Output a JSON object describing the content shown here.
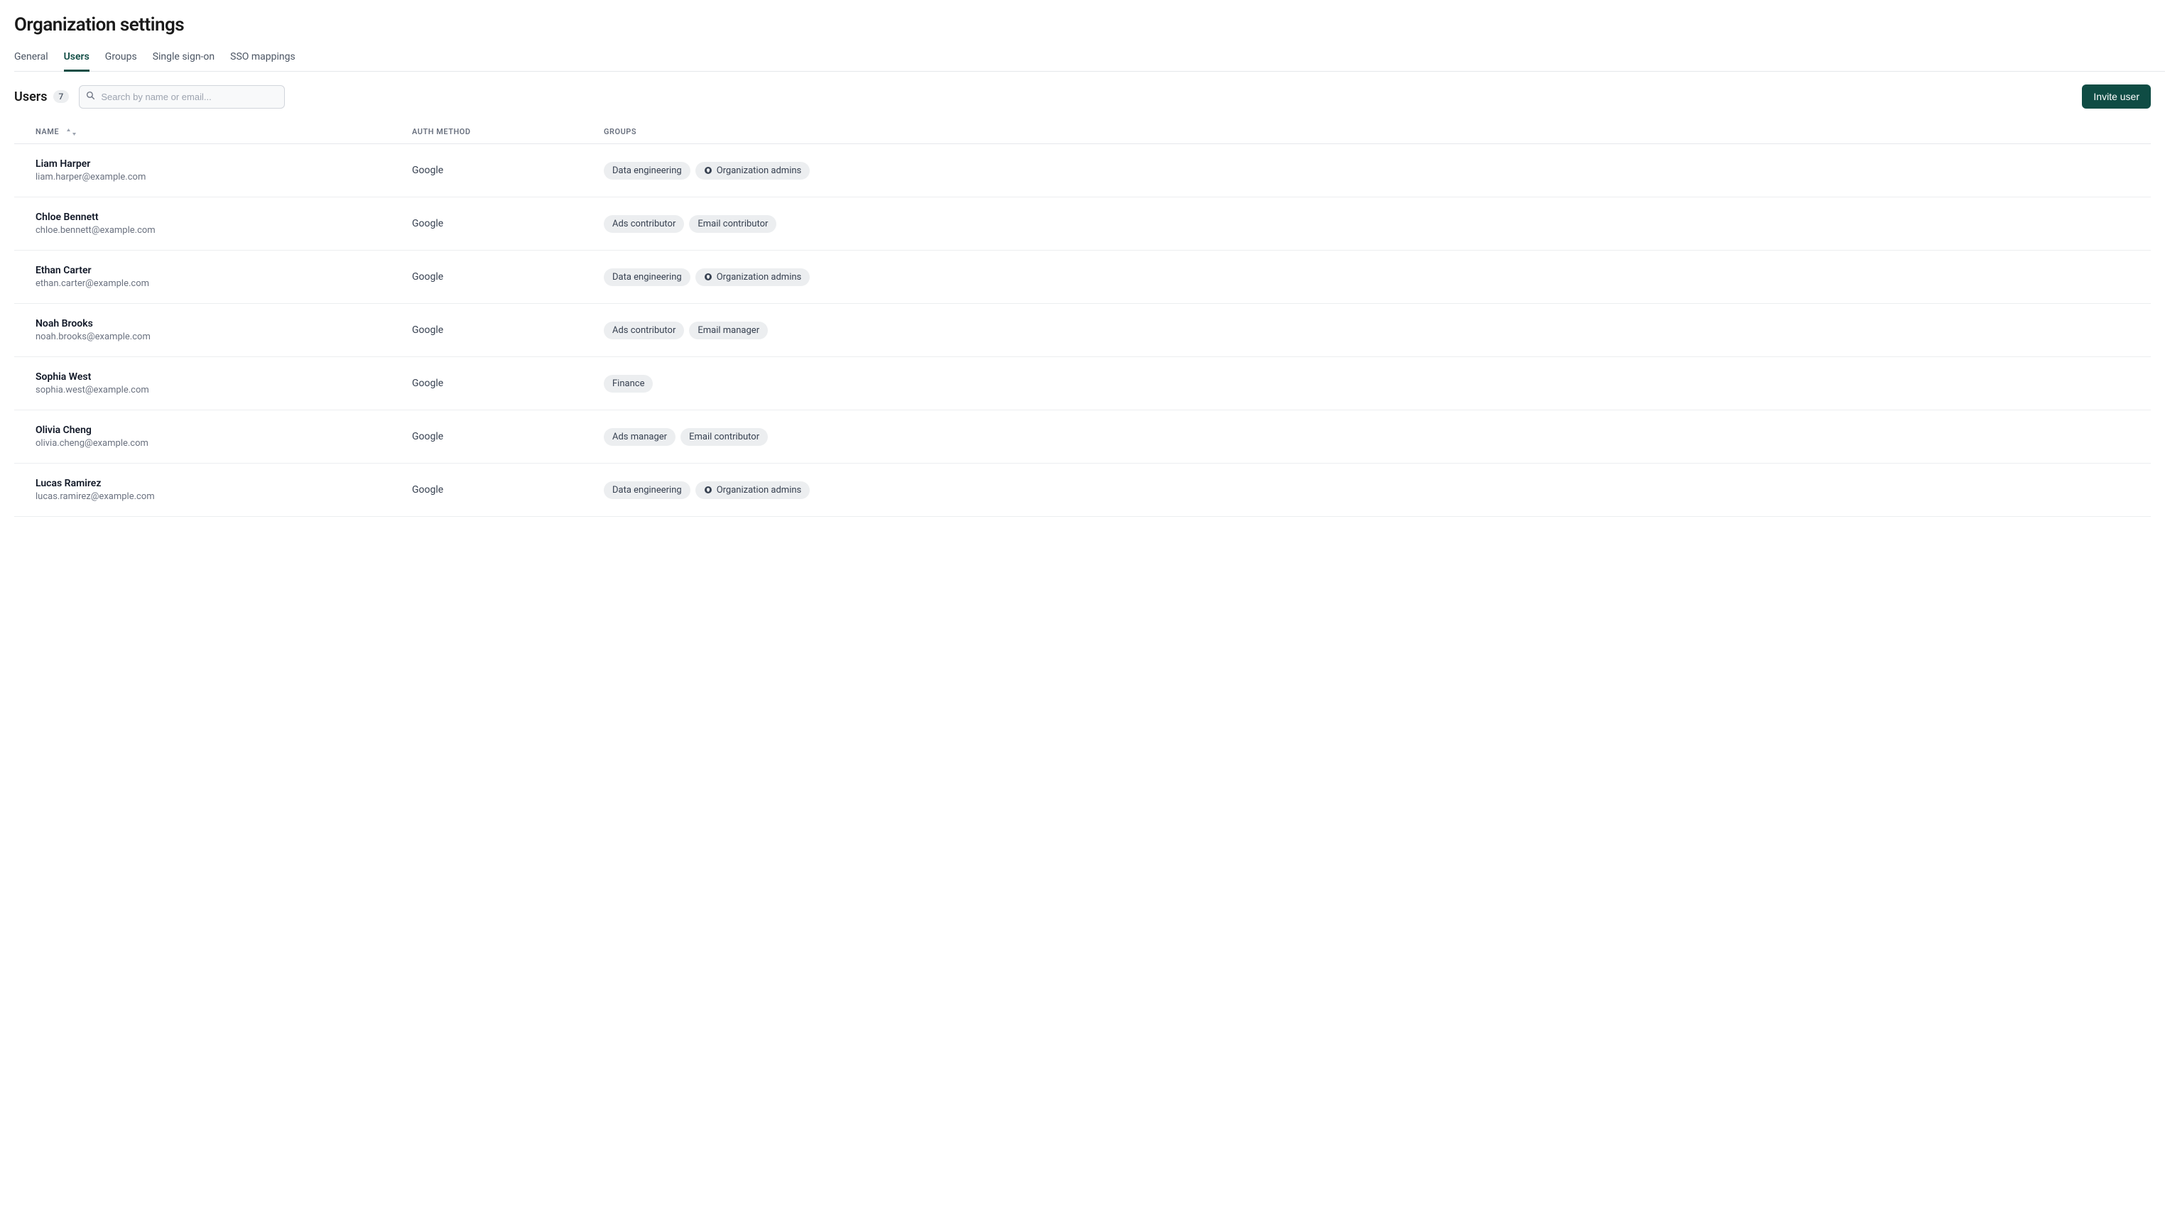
{
  "page": {
    "title": "Organization settings"
  },
  "tabs": [
    {
      "label": "General",
      "active": false
    },
    {
      "label": "Users",
      "active": true
    },
    {
      "label": "Groups",
      "active": false
    },
    {
      "label": "Single sign-on",
      "active": false
    },
    {
      "label": "SSO mappings",
      "active": false
    }
  ],
  "toolbar": {
    "section_title": "Users",
    "count": "7",
    "search_placeholder": "Search by name or email...",
    "invite_label": "Invite user"
  },
  "table": {
    "headers": {
      "name": "NAME",
      "auth": "AUTH METHOD",
      "groups": "GROUPS"
    },
    "rows": [
      {
        "name": "Liam Harper",
        "email": "liam.harper@example.com",
        "auth": "Google",
        "groups": [
          {
            "label": "Data engineering",
            "icon": null
          },
          {
            "label": "Organization admins",
            "icon": "shield"
          }
        ]
      },
      {
        "name": "Chloe Bennett",
        "email": "chloe.bennett@example.com",
        "auth": "Google",
        "groups": [
          {
            "label": "Ads contributor",
            "icon": null
          },
          {
            "label": "Email contributor",
            "icon": null
          }
        ]
      },
      {
        "name": "Ethan Carter",
        "email": "ethan.carter@example.com",
        "auth": "Google",
        "groups": [
          {
            "label": "Data engineering",
            "icon": null
          },
          {
            "label": "Organization admins",
            "icon": "shield"
          }
        ]
      },
      {
        "name": "Noah Brooks",
        "email": "noah.brooks@example.com",
        "auth": "Google",
        "groups": [
          {
            "label": "Ads contributor",
            "icon": null
          },
          {
            "label": "Email manager",
            "icon": null
          }
        ]
      },
      {
        "name": "Sophia West",
        "email": "sophia.west@example.com",
        "auth": "Google",
        "groups": [
          {
            "label": "Finance",
            "icon": null
          }
        ]
      },
      {
        "name": "Olivia Cheng",
        "email": "olivia.cheng@example.com",
        "auth": "Google",
        "groups": [
          {
            "label": "Ads manager",
            "icon": null
          },
          {
            "label": "Email contributor",
            "icon": null
          }
        ]
      },
      {
        "name": "Lucas Ramirez",
        "email": "lucas.ramirez@example.com",
        "auth": "Google",
        "groups": [
          {
            "label": "Data engineering",
            "icon": null
          },
          {
            "label": "Organization admins",
            "icon": "shield"
          }
        ]
      }
    ]
  }
}
